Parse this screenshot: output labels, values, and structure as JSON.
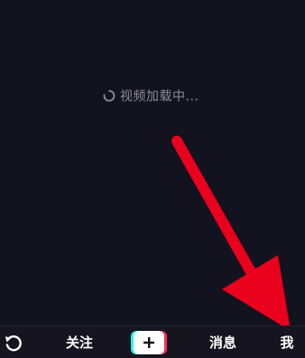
{
  "loading": {
    "text": "视频加载中..."
  },
  "tabs": {
    "refresh_icon": "refresh-icon",
    "follow_label": "关注",
    "create_icon": "plus-icon",
    "messages_label": "消息",
    "me_label": "我"
  },
  "colors": {
    "background": "#13121f",
    "annotation_arrow": "#e8001c",
    "accent_cyan": "#25f4ee",
    "accent_red": "#fe2c55"
  }
}
